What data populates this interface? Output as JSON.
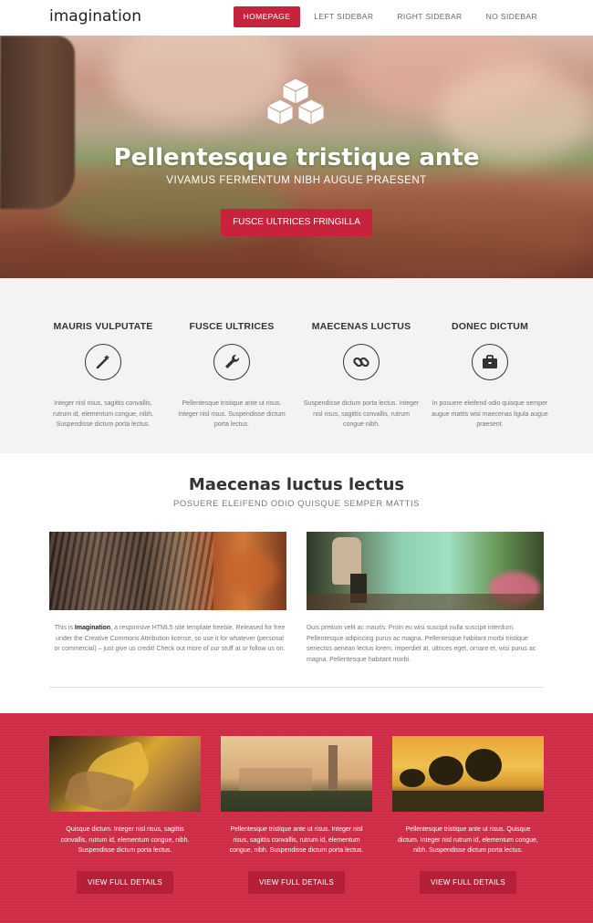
{
  "header": {
    "logo": "imagination",
    "nav": [
      "HOMEPAGE",
      "LEFT SIDEBAR",
      "RIGHT SIDEBAR",
      "NO SIDEBAR"
    ]
  },
  "hero": {
    "icon": "cubes-icon",
    "title": "Pellentesque tristique ante",
    "subtitle": "VIVAMUS FERMENTUM NIBH AUGUE PRAESENT",
    "button": "FUSCE ULTRICES FRINGILLA"
  },
  "features": [
    {
      "title": "MAURIS VULPUTATE",
      "icon": "magic-wand-icon",
      "text": "Integer nisl risus, sagittis convallis, rutrum id, elementum congue, nibh. Suspendisse dictum porta lectus."
    },
    {
      "title": "FUSCE ULTRICES",
      "icon": "wrench-icon",
      "text": "Pellentesque tristique ante ut risus. Integer nisl risus. Suspendisse dictum porta lectus."
    },
    {
      "title": "MAECENAS LUCTUS",
      "icon": "chain-link-icon",
      "text": "Suspendisse dictum porta lectus. Integer nisl risus, sagittis convallis, rutrum congue nibh."
    },
    {
      "title": "DONEC DICTUM",
      "icon": "briefcase-icon",
      "text": "In posuere eleifend odio quisque semper augue mattis wisi maecenas ligula augue praesent."
    }
  ],
  "section2": {
    "title": "Maecenas luctus lectus",
    "subtitle": "POSUERE ELEIFEND ODIO QUISQUE SEMPER MATTIS",
    "left_text_pre": "This is ",
    "left_text_bold": "Imagination",
    "left_text_post": ", a responsive HTML5 site template freebie. Released for free under the Creative Commons Attribution license, so use it for whatever (personal or commercial) – just give us credit! Check out more of our stuff at or follow us on.",
    "right_text": "Duis pretium velit ac mauris. Proin eu wisi suscipit nulla suscipit interdum. Pellentesque adipiscing purus ac magna. Pellentesque habitant morbi tristique senectus aenean lectus lorem, imperdiet at, ultrices eget, ornare et, wisi purus ac magna. Pellentesque habitant morbi."
  },
  "cards": [
    {
      "text": "Quisque dictum. Integer nisl risus, sagittis convallis, rutrum id, elementum congue, nibh. Suspendisse dictum porta lectus.",
      "button": "VIEW FULL DETAILS"
    },
    {
      "text": "Pellentesque tristique ante ut risus. Integer nisl risus, sagittis convallis, rutrum id, elementum congue, nibh. Suspendisse dictum porta lectus.",
      "button": "VIEW FULL DETAILS"
    },
    {
      "text": "Pellentesque tristique ante ut risus. Quisque dictum. Integer nisl rutrum id, elementum congue, nibh. Suspendisse dictum porta lectus.",
      "button": "VIEW FULL DETAILS"
    }
  ],
  "colors": {
    "accent": "#c8233d",
    "red_band": "#d12d48",
    "feature_bg": "#f3f3f3"
  }
}
